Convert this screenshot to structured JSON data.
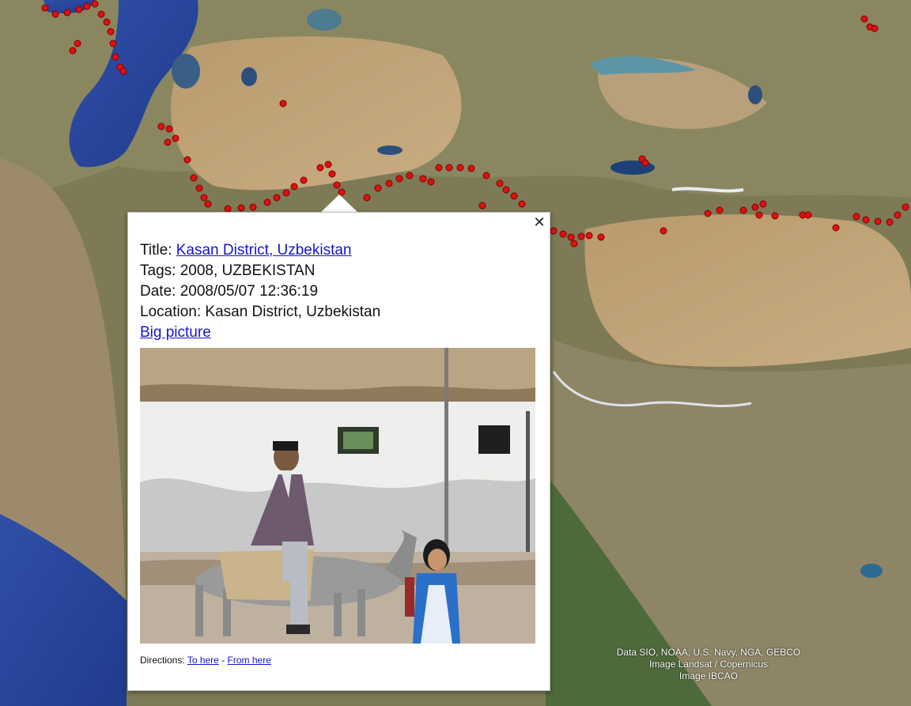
{
  "map": {
    "attribution": [
      "Data SIO, NOAA, U.S. Navy, NGA, GEBCO",
      "Image Landsat / Copernicus",
      "Image IBCAO"
    ],
    "marker_color": "#e01010"
  },
  "balloon": {
    "close_icon": "close-icon",
    "title_label": "Title:",
    "title_link": "Kasan District, Uzbekistan",
    "tags_label": "Tags:",
    "tags_value": "2008, UZBEKISTAN",
    "date_label": "Date:",
    "date_value": "2008/05/07 12:36:19",
    "location_label": "Location:",
    "location_value": "Kasan District, Uzbekistan",
    "big_picture_link": "Big picture",
    "directions_label": "Directions:",
    "to_here": "To here",
    "separator": "-",
    "from_here": "From here"
  }
}
